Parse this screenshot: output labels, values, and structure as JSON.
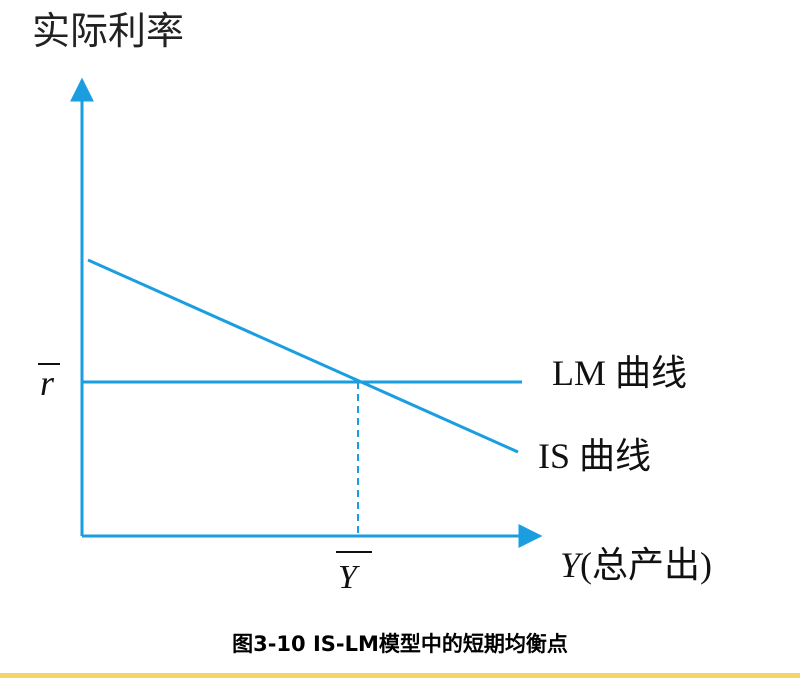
{
  "y_axis_label": "实际利率",
  "x_axis_label_var": "Y",
  "x_axis_label_text": "(总产出)",
  "r_bar_label": "r",
  "y_bar_label": "Y",
  "lm_label": "LM 曲线",
  "is_label": "IS 曲线",
  "caption": "图3-10 IS-LM模型中的短期均衡点",
  "colors": {
    "line": "#1a9ee0",
    "text": "#111111",
    "bottom_bar": "#f6d36b"
  }
}
